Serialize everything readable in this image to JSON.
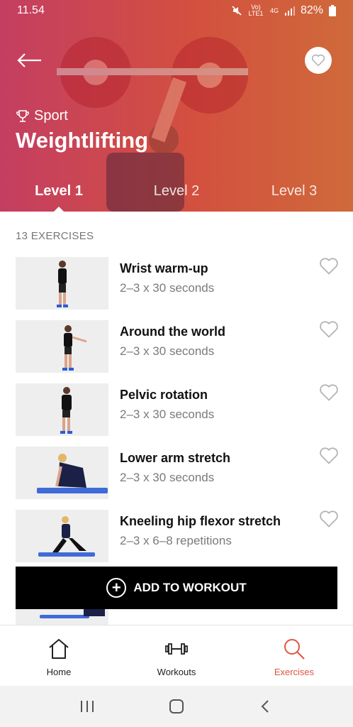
{
  "status": {
    "time": "11.54",
    "battery": "82%",
    "network_top": "Vo) LTE1",
    "network_gen": "4G"
  },
  "header": {
    "category": "Sport",
    "title": "Weightlifting"
  },
  "tabs": [
    {
      "label": "Level 1",
      "active": true
    },
    {
      "label": "Level 2",
      "active": false
    },
    {
      "label": "Level 3",
      "active": false
    }
  ],
  "exercise_count": "13 EXERCISES",
  "exercises": [
    {
      "name": "Wrist warm-up",
      "detail": "2–3 x 30 seconds"
    },
    {
      "name": "Around the world",
      "detail": "2–3 x 30 seconds"
    },
    {
      "name": "Pelvic rotation",
      "detail": "2–3 x 30 seconds"
    },
    {
      "name": "Lower arm stretch",
      "detail": "2–3 x 30 seconds"
    },
    {
      "name": "Kneeling hip flexor stretch",
      "detail": "2–3 x 6–8 repetitions"
    }
  ],
  "add_button": {
    "label": "ADD TO WORKOUT"
  },
  "bottom_nav": [
    {
      "label": "Home",
      "icon": "home-icon"
    },
    {
      "label": "Workouts",
      "icon": "dumbbell-icon"
    },
    {
      "label": "Exercises",
      "icon": "search-icon",
      "active": true
    }
  ],
  "colors": {
    "accent": "#e0553f",
    "hero_start": "#c43e61",
    "hero_end": "#cf6a3a"
  }
}
